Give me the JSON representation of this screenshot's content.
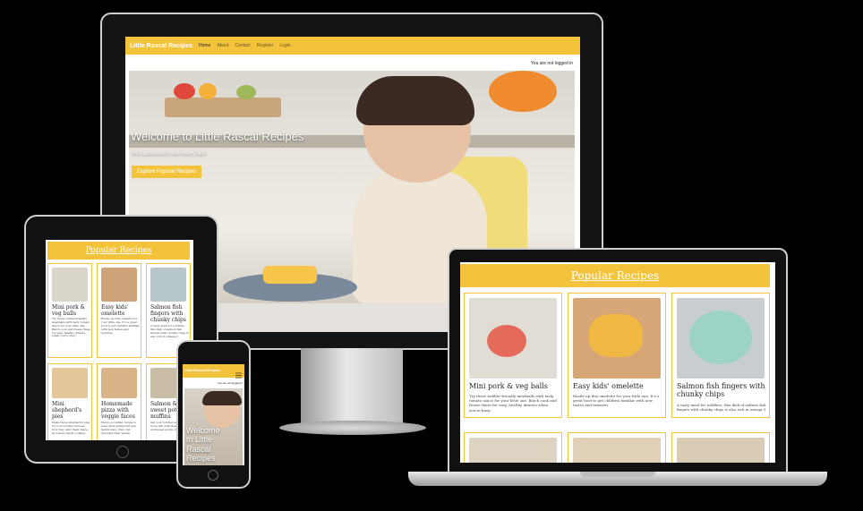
{
  "site": {
    "brand": "Little Rascal Recipes",
    "nav": [
      "Home",
      "About",
      "Contact",
      "Register",
      "Login"
    ],
    "login_status": "You are not logged in"
  },
  "hero": {
    "title": "Welcome to Little Rascal Recipes",
    "subtitle": "Mini adventures with every bite!",
    "button": "Explore Popular Recipes",
    "phone_title": "Welcome to Little Rascal Recipes"
  },
  "popular": {
    "heading": "Popular Recipes",
    "recipes": [
      {
        "title": "Mini pork & veg balls",
        "desc": "Try these toddler-friendly meatballs with tasty tomato sauce for your little one. Batch cook and freeze these for easy, healthy dinners when you're busy."
      },
      {
        "title": "Easy kids' omelette",
        "desc": "Rustle up this omelette for your little one. It's a great food to get children familiar with new tastes and textures."
      },
      {
        "title": "Salmon fish fingers with chunky chips",
        "desc": "A tasty meal for toddlers, this dish of salmon fish fingers with chunky chips is also rich in omega-3"
      },
      {
        "title": "Mini shepherd's pies",
        "desc": "Make these shepherd's pies for your toddler and see how they and! them share, as well as batch cooking."
      },
      {
        "title": "Homemade pizza with veggie faces",
        "desc": "Here's a toddler recipe to keep little bellies full and hands busy. They can decorate their pizzas"
      },
      {
        "title": "Salmon & sweet potato muffins",
        "desc": "Get your toddler eating more fish with these salmon and sweet potato muffins"
      }
    ]
  },
  "colors": {
    "accent": "#f4c33c",
    "card_border": "#f4c33c"
  },
  "icons": {
    "menu": "hamburger-icon"
  }
}
